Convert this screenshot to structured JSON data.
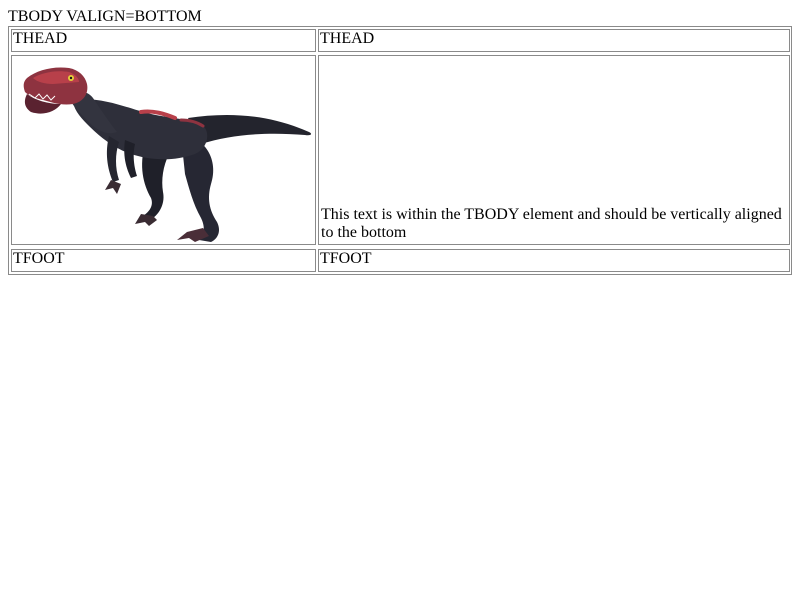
{
  "caption": "TBODY VALIGN=BOTTOM",
  "thead": {
    "left": "THEAD",
    "right": "THEAD"
  },
  "tbody": {
    "image_icon": "velociraptor-image",
    "text": "This text is within the TBODY element and should be vertically aligned to the bottom"
  },
  "tfoot": {
    "left": "TFOOT",
    "right": "TFOOT"
  },
  "colors": {
    "border": "#8a8a8a",
    "raptor_body": "#2e2f3a",
    "raptor_accent": "#b8404a",
    "raptor_eye": "#e6d23a"
  }
}
